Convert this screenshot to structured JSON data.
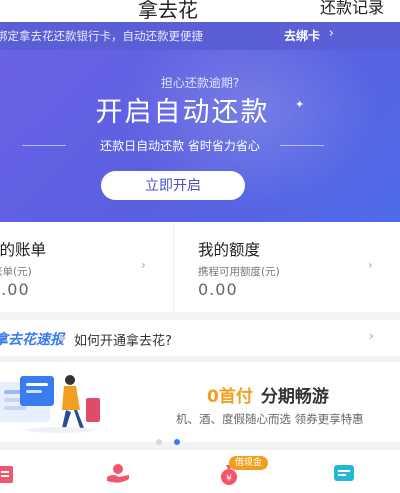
{
  "header": {
    "title": "拿去花",
    "right_action": "还款记录"
  },
  "notice": {
    "text": "绑定拿去花还款银行卡，自动还款更便捷",
    "link": "去绑卡"
  },
  "banner": {
    "subtitle": "担心还款逾期?",
    "title": "开启自动还款",
    "tagline": "还款日自动还款 省时省力省心",
    "button": "立即开启"
  },
  "cards": [
    {
      "title": "我的账单",
      "sub": "账单(元)",
      "value": "0.00"
    },
    {
      "title": "我的额度",
      "sub": "携程可用额度(元)",
      "value": "0.00"
    }
  ],
  "news": {
    "brand": "拿去花速报",
    "text": "如何开通拿去花?"
  },
  "promo": {
    "highlight": "0首付",
    "title_rest": "分期畅游",
    "subtitle": "机、酒、度假随心而选 领券更享特惠"
  },
  "quick": {
    "badge": "借现金"
  },
  "colors": {
    "brand_blue": "#3a7bf0",
    "banner": "#5a60e0",
    "accent_orange": "#f0a01e"
  }
}
